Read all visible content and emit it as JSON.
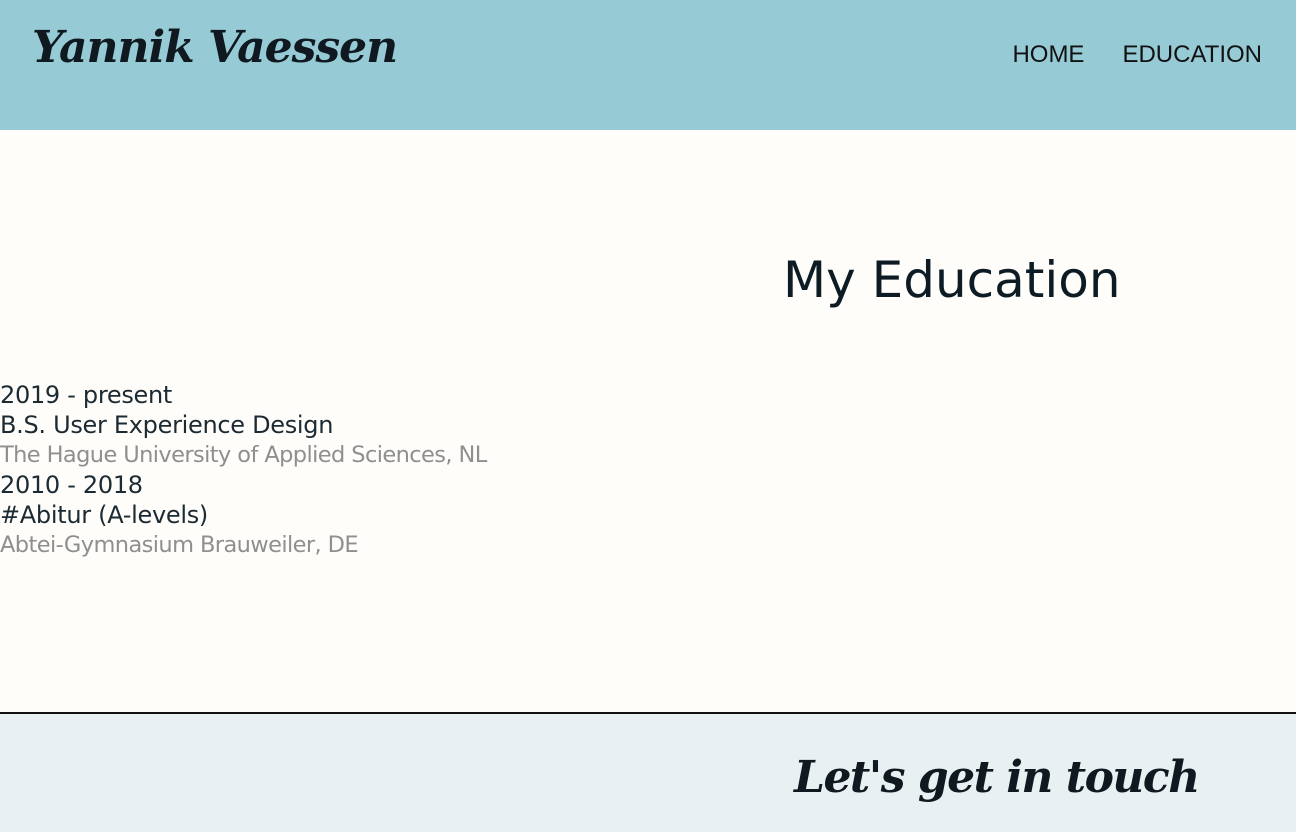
{
  "header": {
    "logo_text": "Yannik Vaessen",
    "background_color": "#96cbd6",
    "nav": [
      {
        "label": "HOME"
      },
      {
        "label": "EDUCATION"
      }
    ]
  },
  "main": {
    "title": "My Education",
    "education": [
      {
        "period": "2019 - present",
        "degree": "B.S. User Experience Design",
        "institution": "The Hague University of Applied Sciences, NL"
      },
      {
        "period": "2010 - 2018",
        "degree": "#Abitur (A-levels)",
        "institution": "Abtei-Gymnasium Brauweiler, DE"
      }
    ]
  },
  "footer": {
    "title": "Let's get in touch",
    "background_color": "#e8f0f2"
  }
}
